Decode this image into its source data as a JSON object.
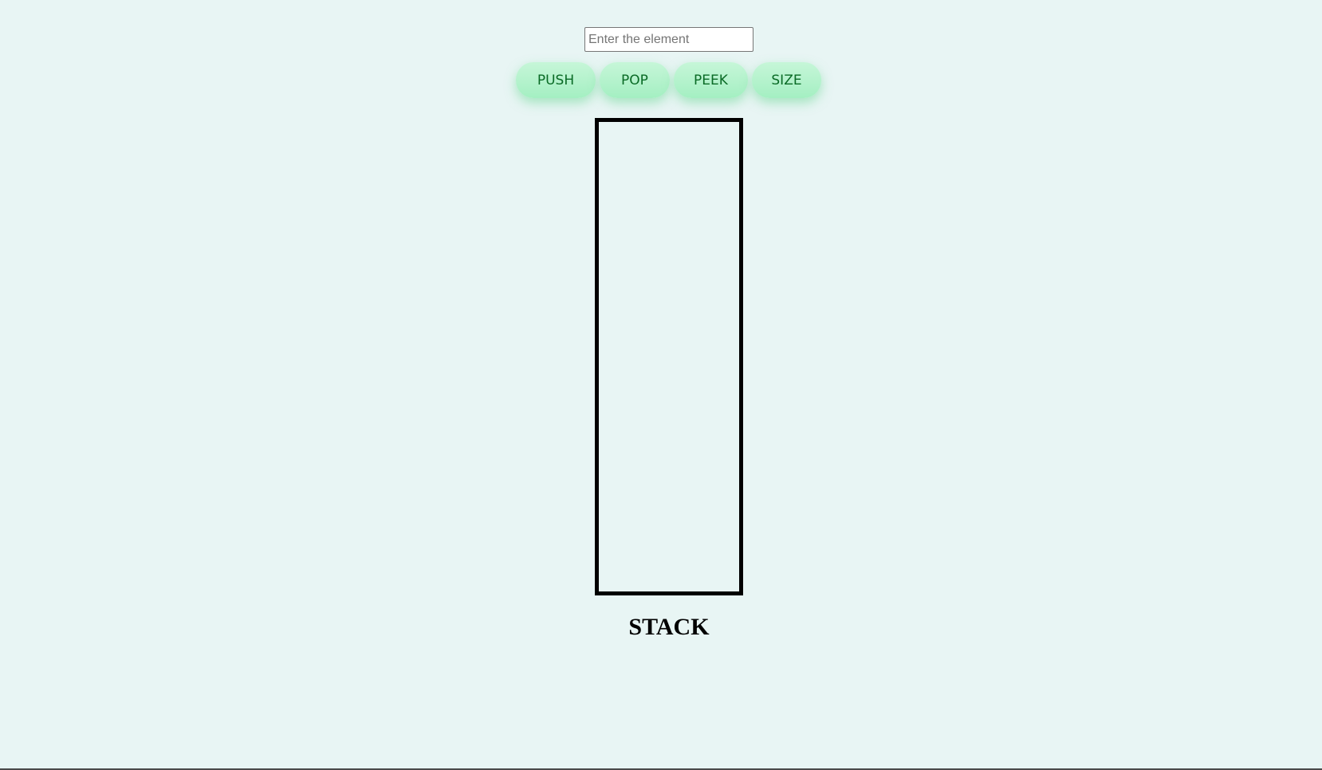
{
  "input": {
    "placeholder": "Enter the element",
    "value": ""
  },
  "buttons": {
    "push": "PUSH",
    "pop": "POP",
    "peek": "PEEK",
    "size": "SIZE"
  },
  "stack": {
    "label": "STACK",
    "items": []
  },
  "colors": {
    "background": "#e8f5f4",
    "button_fill": "#b4f2cc",
    "button_text": "#0a6b26",
    "stack_border": "#000000"
  }
}
